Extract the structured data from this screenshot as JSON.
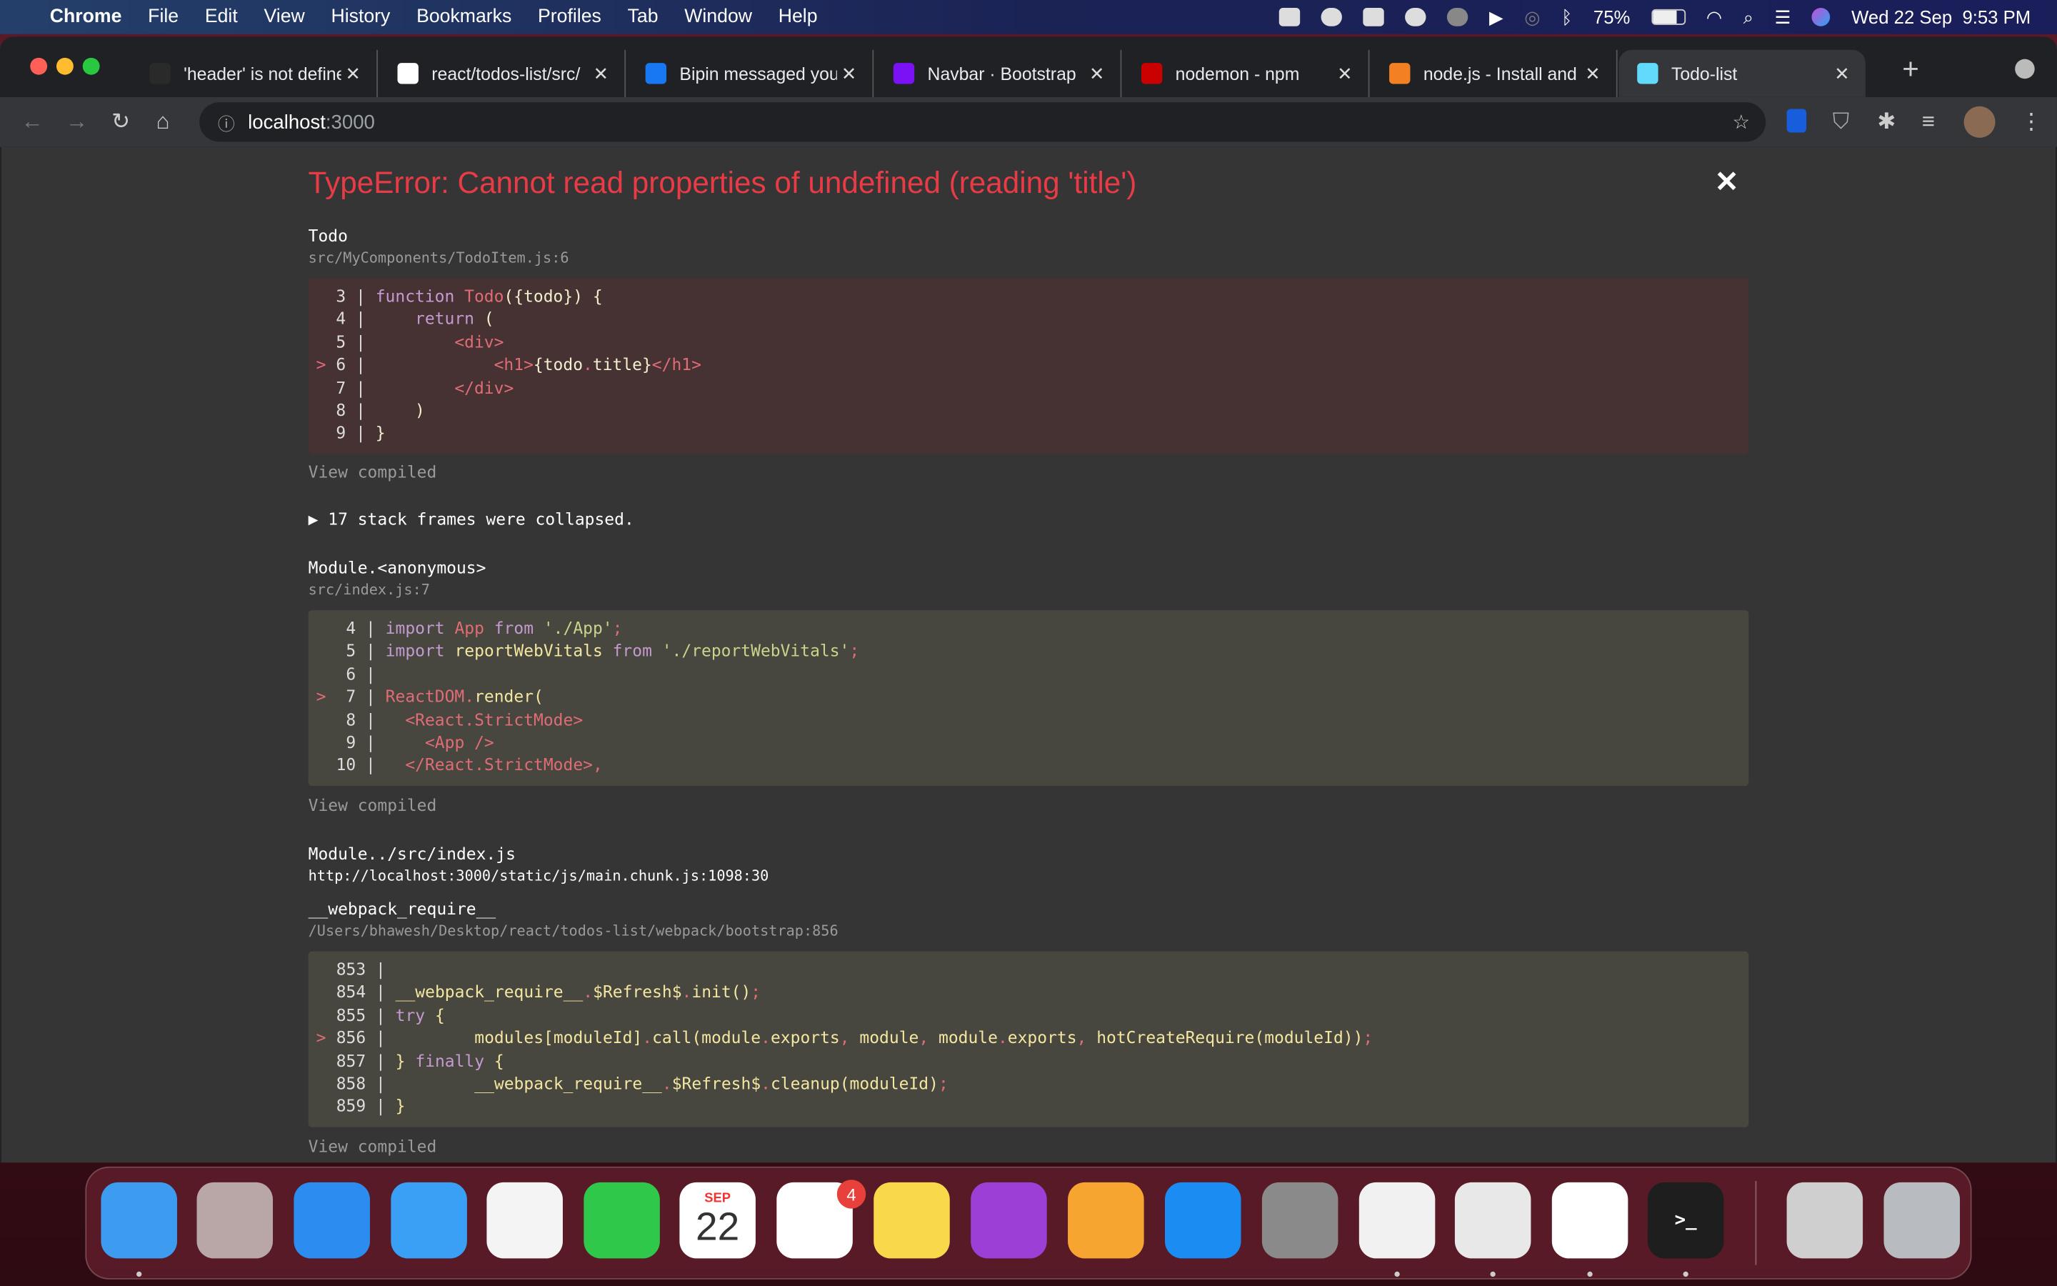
{
  "menubar": {
    "apple": "",
    "items": [
      "Chrome",
      "File",
      "Edit",
      "View",
      "History",
      "Bookmarks",
      "Profiles",
      "Tab",
      "Window",
      "Help"
    ],
    "battery": "75%",
    "datetime": "Wed 22 Sep  9:53 PM"
  },
  "tabs": [
    {
      "title": "'header' is not defined",
      "favicon": "tool-icon",
      "color": "#2a2a2a"
    },
    {
      "title": "react/todos-list/src/",
      "favicon": "github-icon",
      "color": "#ffffff"
    },
    {
      "title": "Bipin messaged you",
      "favicon": "facebook-icon",
      "color": "#1877f2"
    },
    {
      "title": "Navbar · Bootstrap",
      "favicon": "bootstrap-icon",
      "color": "#7a12f5"
    },
    {
      "title": "nodemon - npm",
      "favicon": "npm-icon",
      "color": "#cb0000"
    },
    {
      "title": "node.js - Install and",
      "favicon": "stackoverflow-icon",
      "color": "#f48024"
    },
    {
      "title": "Todo-list",
      "favicon": "react-icon",
      "color": "#61dafb",
      "active": true
    }
  ],
  "address": {
    "host": "localhost",
    "port": ":3000"
  },
  "error": {
    "title": "TypeError: Cannot read properties of undefined (reading 'title')",
    "view_compiled": "View compiled",
    "collapsed": "▶ 17 stack frames were collapsed.",
    "frames": [
      {
        "name": "Todo",
        "location": "src/MyComponents/TodoItem.js:6",
        "bg": "#473233",
        "lines": [
          {
            "n": "3",
            "t": [
              [
                "kw",
                "function "
              ],
              [
                "red",
                "Todo"
              ],
              [
                "txt",
                "({todo}) {"
              ]
            ]
          },
          {
            "n": "4",
            "t": [
              [
                "txt",
                "    "
              ],
              [
                "kw",
                "return"
              ],
              [
                "txt",
                " ("
              ]
            ]
          },
          {
            "n": "5",
            "t": [
              [
                "txt",
                "        "
              ],
              [
                "red",
                "<div>"
              ]
            ]
          },
          {
            "n": "6",
            "hl": true,
            "t": [
              [
                "txt",
                "            "
              ],
              [
                "red",
                "<h1>"
              ],
              [
                "txt",
                "{todo"
              ],
              [
                "red",
                "."
              ],
              [
                "txt",
                "title}"
              ],
              [
                "red",
                "</h1>"
              ]
            ]
          },
          {
            "n": "7",
            "t": [
              [
                "txt",
                "        "
              ],
              [
                "red",
                "</div>"
              ]
            ]
          },
          {
            "n": "8",
            "t": [
              [
                "txt",
                "    )"
              ]
            ]
          },
          {
            "n": "9",
            "t": [
              [
                "txt",
                "}"
              ]
            ]
          }
        ]
      },
      {
        "name": "Module.<anonymous>",
        "location": "src/index.js:7",
        "bg": "#47463f",
        "lines": [
          {
            "n": "4",
            "t": [
              [
                "kw",
                "import "
              ],
              [
                "red",
                "App"
              ],
              [
                "kw",
                " from "
              ],
              [
                "str",
                "'./App'"
              ],
              [
                "red",
                ";"
              ]
            ]
          },
          {
            "n": "5",
            "t": [
              [
                "kw",
                "import "
              ],
              [
                "id",
                "reportWebVitals"
              ],
              [
                "kw",
                " from "
              ],
              [
                "str",
                "'./reportWebVitals'"
              ],
              [
                "red",
                ";"
              ]
            ]
          },
          {
            "n": "6",
            "t": []
          },
          {
            "n": "7",
            "hl": true,
            "t": [
              [
                "red",
                "ReactDOM."
              ],
              [
                "id",
                "render("
              ]
            ]
          },
          {
            "n": "8",
            "t": [
              [
                "txt",
                "  "
              ],
              [
                "red",
                "<React.StrictMode>"
              ]
            ]
          },
          {
            "n": "9",
            "t": [
              [
                "txt",
                "    "
              ],
              [
                "red",
                "<App />"
              ]
            ]
          },
          {
            "n": "10",
            "t": [
              [
                "txt",
                "  "
              ],
              [
                "red",
                "</React.StrictMode>,"
              ]
            ]
          }
        ]
      },
      {
        "name": "Module../src/index.js",
        "location": "http://localhost:3000/static/js/main.chunk.js:1098:30"
      },
      {
        "name": "__webpack_require__",
        "location": "/Users/bhawesh/Desktop/react/todos-list/webpack/bootstrap:856",
        "bg": "#47463f",
        "lines": [
          {
            "n": "853",
            "t": []
          },
          {
            "n": "854",
            "t": [
              [
                "id",
                "__webpack_require__"
              ],
              [
                "red",
                "."
              ],
              [
                "id",
                "$Refresh$"
              ],
              [
                "red",
                "."
              ],
              [
                "id",
                "init()"
              ],
              [
                "red",
                ";"
              ]
            ]
          },
          {
            "n": "855",
            "t": [
              [
                "kw",
                "try"
              ],
              [
                "id",
                " {"
              ]
            ]
          },
          {
            "n": "856",
            "hl": true,
            "t": [
              [
                "txt",
                "        "
              ],
              [
                "id",
                "modules[moduleId]"
              ],
              [
                "red",
                "."
              ],
              [
                "id",
                "call(module"
              ],
              [
                "red",
                "."
              ],
              [
                "id",
                "exports"
              ],
              [
                "red",
                ","
              ],
              [
                "id",
                " module"
              ],
              [
                "red",
                ","
              ],
              [
                "id",
                " module"
              ],
              [
                "red",
                "."
              ],
              [
                "id",
                "exports"
              ],
              [
                "red",
                ","
              ],
              [
                "id",
                " hotCreateRequire(moduleId))"
              ],
              [
                "red",
                ";"
              ]
            ]
          },
          {
            "n": "857",
            "t": [
              [
                "id",
                "} "
              ],
              [
                "kw",
                "finally"
              ],
              [
                "id",
                " {"
              ]
            ]
          },
          {
            "n": "858",
            "t": [
              [
                "txt",
                "        "
              ],
              [
                "id",
                "__webpack_require__"
              ],
              [
                "red",
                "."
              ],
              [
                "id",
                "$Refresh$"
              ],
              [
                "red",
                "."
              ],
              [
                "id",
                "cleanup(moduleId)"
              ],
              [
                "red",
                ";"
              ]
            ]
          },
          {
            "n": "859",
            "t": [
              [
                "id",
                "}"
              ]
            ]
          }
        ]
      }
    ]
  },
  "dock": {
    "apps": [
      {
        "name": "finder",
        "color": "#3d9cf0",
        "running": true
      },
      {
        "name": "launchpad",
        "color": "#b9a7a7"
      },
      {
        "name": "safari",
        "color": "#2d8cf0"
      },
      {
        "name": "mail",
        "color": "#3aa0f5"
      },
      {
        "name": "photos",
        "color": "#f4f4f4"
      },
      {
        "name": "facetime",
        "color": "#2fc84a"
      },
      {
        "name": "calendar",
        "color": "#ffffff",
        "month": "SEP",
        "day": "22"
      },
      {
        "name": "reminders",
        "color": "#ffffff",
        "badge": "4"
      },
      {
        "name": "notes",
        "color": "#f9d94a"
      },
      {
        "name": "podcasts",
        "color": "#9b3fd6"
      },
      {
        "name": "pages",
        "color": "#f7a531"
      },
      {
        "name": "app-store",
        "color": "#1b8cf2"
      },
      {
        "name": "system-preferences",
        "color": "#8a8a8a"
      },
      {
        "name": "chrome",
        "color": "#f1f1f1",
        "running": true
      },
      {
        "name": "java",
        "color": "#e8e8e8",
        "running": true
      },
      {
        "name": "vscode",
        "color": "#ffffff",
        "running": true
      },
      {
        "name": "terminal",
        "color": "#1e1e1e",
        "running": true
      },
      {
        "name": "screenshots-folder",
        "color": "#cfcfcf"
      },
      {
        "name": "trash",
        "color": "#b8bcc0"
      }
    ]
  }
}
